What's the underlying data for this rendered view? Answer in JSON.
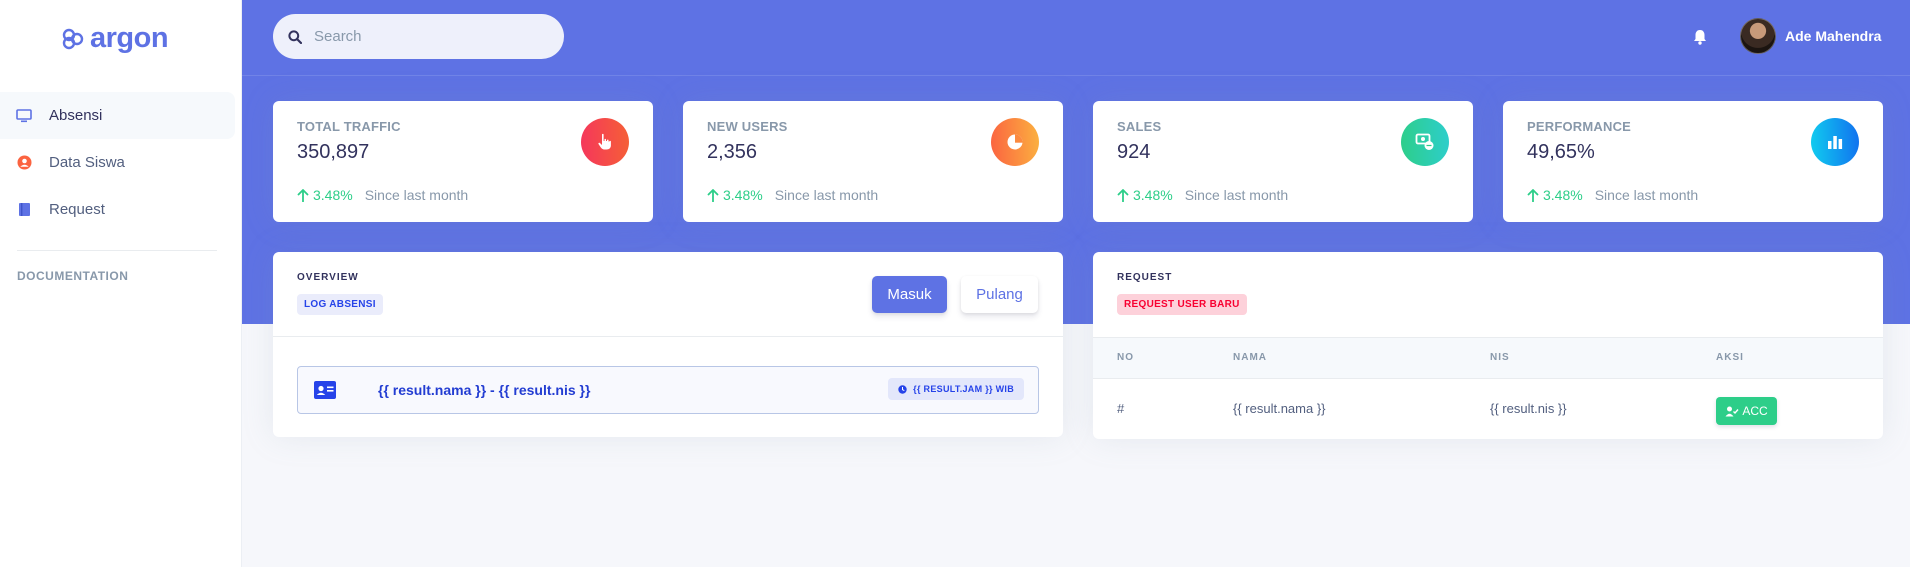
{
  "brand": {
    "name": "argon"
  },
  "sidebar": {
    "items": [
      {
        "label": "Absensi",
        "icon": "monitor-icon",
        "active": true
      },
      {
        "label": "Data Siswa",
        "icon": "user-circle-icon",
        "active": false
      },
      {
        "label": "Request",
        "icon": "book-icon",
        "active": false
      }
    ],
    "heading": "DOCUMENTATION"
  },
  "header": {
    "search_placeholder": "Search",
    "user_name": "Ade Mahendra"
  },
  "stats": [
    {
      "title": "TOTAL TRAFFIC",
      "value": "350,897",
      "change": "3.48%",
      "since": "Since last month",
      "icon": "pointer-hand-icon",
      "color": "#f5365c"
    },
    {
      "title": "NEW USERS",
      "value": "2,356",
      "change": "3.48%",
      "since": "Since last month",
      "icon": "pie-chart-icon",
      "color": "#fb6340"
    },
    {
      "title": "SALES",
      "value": "924",
      "change": "3.48%",
      "since": "Since last month",
      "icon": "money-coins-icon",
      "color": "#2dce89"
    },
    {
      "title": "PERFORMANCE",
      "value": "49,65%",
      "change": "3.48%",
      "since": "Since last month",
      "icon": "bar-chart-icon",
      "color": "#11cdef"
    }
  ],
  "overview": {
    "overline": "OVERVIEW",
    "badge": "LOG ABSENSI",
    "buttons": {
      "masuk": "Masuk",
      "pulang": "Pulang"
    },
    "log": {
      "text": "{{ result.nama }} - {{ result.nis }}",
      "time": "{{ RESULT.JAM }} WIB"
    }
  },
  "request": {
    "overline": "REQUEST",
    "badge": "REQUEST USER BARU",
    "columns": [
      "NO",
      "NAMA",
      "NIS",
      "AKSI"
    ],
    "rows": [
      {
        "no": "#",
        "nama": "{{ result.nama }}",
        "nis": "{{ result.nis }}",
        "action": "ACC"
      }
    ]
  },
  "colors": {
    "primary": "#5e72e4",
    "success": "#2dce89",
    "danger": "#f5365c"
  }
}
